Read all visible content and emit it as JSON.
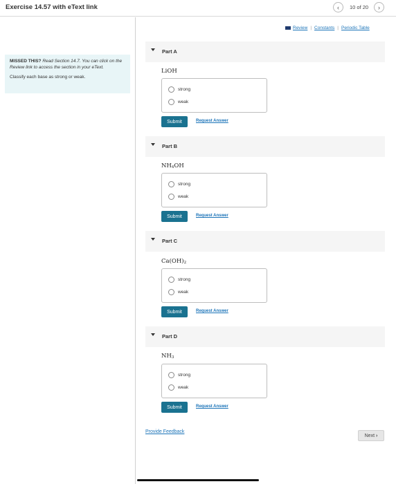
{
  "header": {
    "title": "Exercise 14.57 with eText link",
    "counter": "10 of 20",
    "prev_icon": "chevron-left-icon",
    "next_icon": "chevron-right-icon"
  },
  "sidebar": {
    "missed_label": "MISSED THIS?",
    "missed_text": "Read Section 14.7. You can click on the Review link to access the section in your eText.",
    "instruction": "Classify each base as strong or weak."
  },
  "toolbar": {
    "book_icon": "book-icon",
    "review": "Review",
    "constants": "Constants",
    "periodic_table": "Periodic Table",
    "separator": "|"
  },
  "parts": [
    {
      "label": "Part A",
      "formula_base": "LiOH",
      "formula_sub": "",
      "formula_tail": "",
      "options": [
        "strong",
        "weak"
      ],
      "submit": "Submit",
      "request_answer": "Request Answer"
    },
    {
      "label": "Part B",
      "formula_base": "NH",
      "formula_sub": "4",
      "formula_tail": "OH",
      "options": [
        "strong",
        "weak"
      ],
      "submit": "Submit",
      "request_answer": "Request Answer"
    },
    {
      "label": "Part C",
      "formula_base": "Ca(OH)",
      "formula_sub": "2",
      "formula_tail": "",
      "options": [
        "strong",
        "weak"
      ],
      "submit": "Submit",
      "request_answer": "Request Answer"
    },
    {
      "label": "Part D",
      "formula_base": "NH",
      "formula_sub": "3",
      "formula_tail": "",
      "options": [
        "strong",
        "weak"
      ],
      "submit": "Submit",
      "request_answer": "Request Answer"
    }
  ],
  "footer": {
    "feedback": "Provide Feedback",
    "next": "Next"
  },
  "colors": {
    "accent": "#1a7290",
    "link": "#1a73b8",
    "hint_bg": "#e8f5f7"
  }
}
